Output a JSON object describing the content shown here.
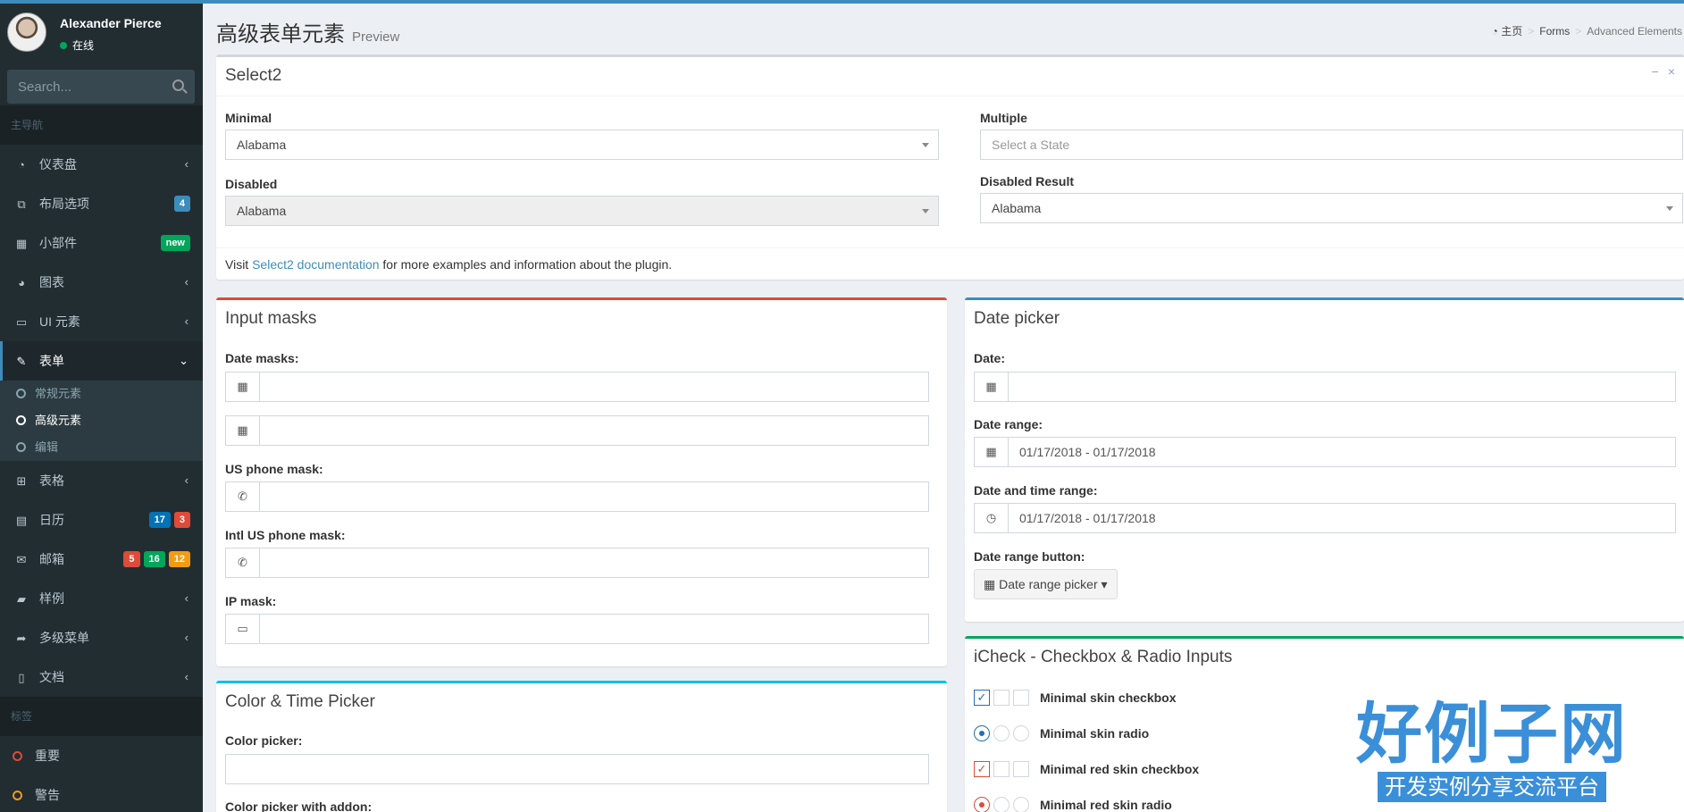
{
  "sidebar": {
    "user": {
      "name": "Alexander Pierce",
      "status": "在线"
    },
    "search": {
      "placeholder": "Search..."
    },
    "main_nav_header": "主导航",
    "items": [
      {
        "label": "仪表盘",
        "icon": "dashboard-icon",
        "glyph": "◔"
      },
      {
        "label": "布局选项",
        "icon": "files-icon",
        "glyph": "⧉",
        "badges": [
          {
            "text": "4",
            "color": "#3c8dbc"
          }
        ]
      },
      {
        "label": "小部件",
        "icon": "th-icon",
        "glyph": "▦",
        "badges": [
          {
            "text": "new",
            "color": "#00a65a"
          }
        ]
      },
      {
        "label": "图表",
        "icon": "pie-chart-icon",
        "glyph": "◕"
      },
      {
        "label": "UI 元素",
        "icon": "laptop-icon",
        "glyph": "▭"
      },
      {
        "label": "表单",
        "icon": "edit-icon",
        "glyph": "✎"
      }
    ],
    "form_sub": [
      "常规元素",
      "高级元素",
      "编辑"
    ],
    "items2": [
      {
        "label": "表格",
        "icon": "table-icon",
        "glyph": "⊞"
      },
      {
        "label": "日历",
        "icon": "calendar-icon",
        "glyph": "▤",
        "badges": [
          {
            "text": "17",
            "color": "#0073b7"
          },
          {
            "text": "3",
            "color": "#dd4b39"
          }
        ]
      },
      {
        "label": "邮箱",
        "icon": "envelope-icon",
        "glyph": "✉",
        "badges": [
          {
            "text": "5",
            "color": "#dd4b39"
          },
          {
            "text": "16",
            "color": "#00a65a"
          },
          {
            "text": "12",
            "color": "#f39c12"
          }
        ]
      },
      {
        "label": "样例",
        "icon": "folder-icon",
        "glyph": "▰"
      },
      {
        "label": "多级菜单",
        "icon": "share-icon",
        "glyph": "➦"
      },
      {
        "label": "文档",
        "icon": "book-icon",
        "glyph": "▯"
      }
    ],
    "labels_header": "标签",
    "labels": [
      {
        "label": "重要",
        "color": "#dd4b39"
      },
      {
        "label": "警告",
        "color": "#f39c12"
      }
    ]
  },
  "header": {
    "title": "高级表单元素",
    "subtitle": "Preview"
  },
  "breadcrumb": {
    "home": "主页",
    "forms": "Forms",
    "current": "Advanced Elements"
  },
  "select2": {
    "title": "Select2",
    "minimal_label": "Minimal",
    "minimal_value": "Alabama",
    "disabled_label": "Disabled",
    "disabled_value": "Alabama",
    "multiple_label": "Multiple",
    "multiple_placeholder": "Select a State",
    "disabled_result_label": "Disabled Result",
    "disabled_result_value": "Alabama",
    "note_pre": "Visit ",
    "note_link": "Select2 documentation",
    "note_post": " for more examples and information about the plugin."
  },
  "input_masks": {
    "title": "Input masks",
    "date_masks_label": "Date masks:",
    "us_phone_label": "US phone mask:",
    "intl_phone_label": "Intl US phone mask:",
    "ip_label": "IP mask:"
  },
  "color_time": {
    "title": "Color & Time Picker",
    "color_picker_label": "Color picker:",
    "color_addon_label": "Color picker with addon:"
  },
  "date_picker": {
    "title": "Date picker",
    "date_label": "Date:",
    "range_label": "Date range:",
    "range_value": "01/17/2018 - 01/17/2018",
    "datetime_label": "Date and time range:",
    "datetime_value": "01/17/2018 - 01/17/2018",
    "button_label": "Date range button:",
    "button_text": "Date range picker"
  },
  "icheck": {
    "title": "iCheck - Checkbox & Radio Inputs",
    "rows": [
      "Minimal skin checkbox",
      "Minimal skin radio",
      "Minimal red skin checkbox",
      "Minimal red skin radio"
    ]
  },
  "watermark": {
    "big": "好例子网",
    "small": "开发实例分享交流平台"
  },
  "colors": {
    "primary": "#3c8dbc",
    "danger": "#dd4b39",
    "info": "#00c0ef",
    "success": "#00a65a",
    "warning": "#f39c12",
    "sidebar": "#222d32"
  }
}
